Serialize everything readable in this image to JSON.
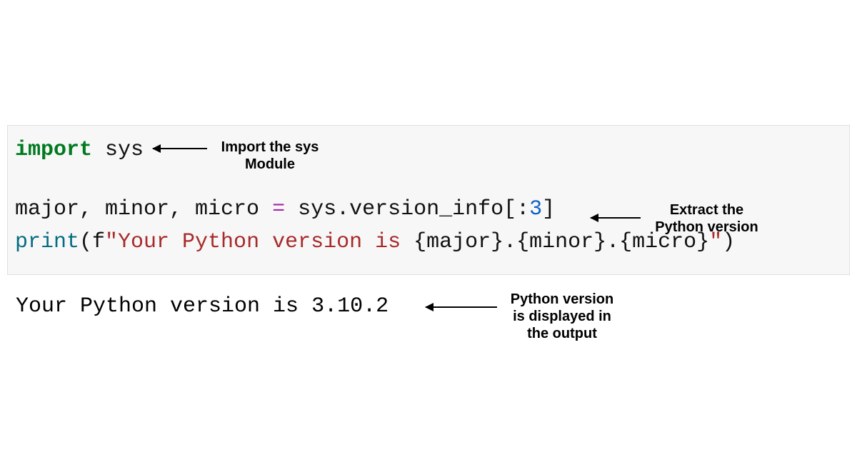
{
  "code": {
    "line1": {
      "kw": "import",
      "rest": " sys"
    },
    "line2": {
      "lhs": "major, minor, micro ",
      "eq": "=",
      "mid1": " sys.version_info[:",
      "num": "3",
      "mid2": "]"
    },
    "line3": {
      "fn": "print",
      "paren_open": "(f",
      "str1": "\"Your Python version is ",
      "interp": "{major}.{minor}.{micro}",
      "str2": "\"",
      "paren_close": ")"
    }
  },
  "output": "Your Python version is 3.10.2",
  "annotations": {
    "a1_line1": "Import the sys",
    "a1_line2": "Module",
    "a2_line1": "Extract the",
    "a2_line2": "Python version",
    "a3_line1": "Python version",
    "a3_line2": "is displayed in",
    "a3_line3": "the output"
  }
}
